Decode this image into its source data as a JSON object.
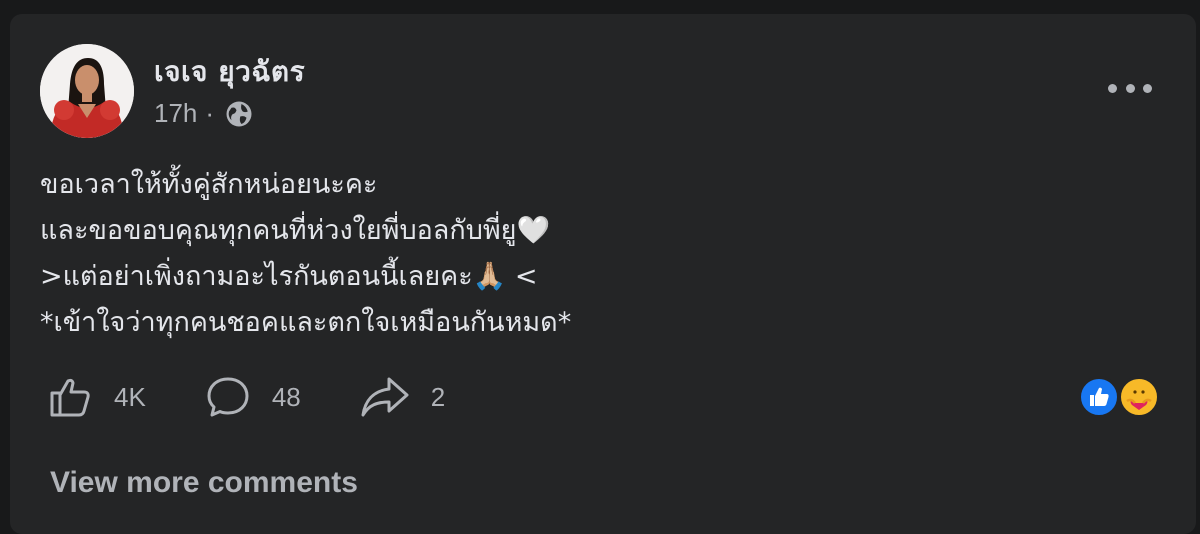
{
  "post": {
    "author": "เจเจ ยุวฉัตร",
    "time": "17h",
    "separator": "·",
    "privacy_icon": "globe-icon",
    "menu_icon": "more-horizontal-icon",
    "lines": [
      "ขอเวลาให้ทั้งคู่สักหน่อยนะคะ",
      "และขอขอบคุณทุกคนที่ห่วงใยพี่บอลกับพี่ยู🤍",
      ">แต่อย่าเพิ่งถามอะไรกันตอนนี้เลยคะ🙏🏼 <",
      "*เข้าใจว่าทุกคนชอคและตกใจเหมือนกันหมด*"
    ]
  },
  "stats": {
    "likes": "4K",
    "comments": "48",
    "shares": "2",
    "like_icon": "thumbs-up-icon",
    "comment_icon": "comment-bubble-icon",
    "share_icon": "share-arrow-icon",
    "reactions": [
      "like-reaction-icon",
      "care-reaction-icon"
    ]
  },
  "comments": {
    "view_more_label": "View more comments"
  },
  "colors": {
    "background": "#18191a",
    "card": "#242526",
    "primary_text": "#e4e6eb",
    "secondary_text": "#b0b3b8",
    "like_blue": "#1877f2",
    "care_yellow": "#f7b928"
  }
}
